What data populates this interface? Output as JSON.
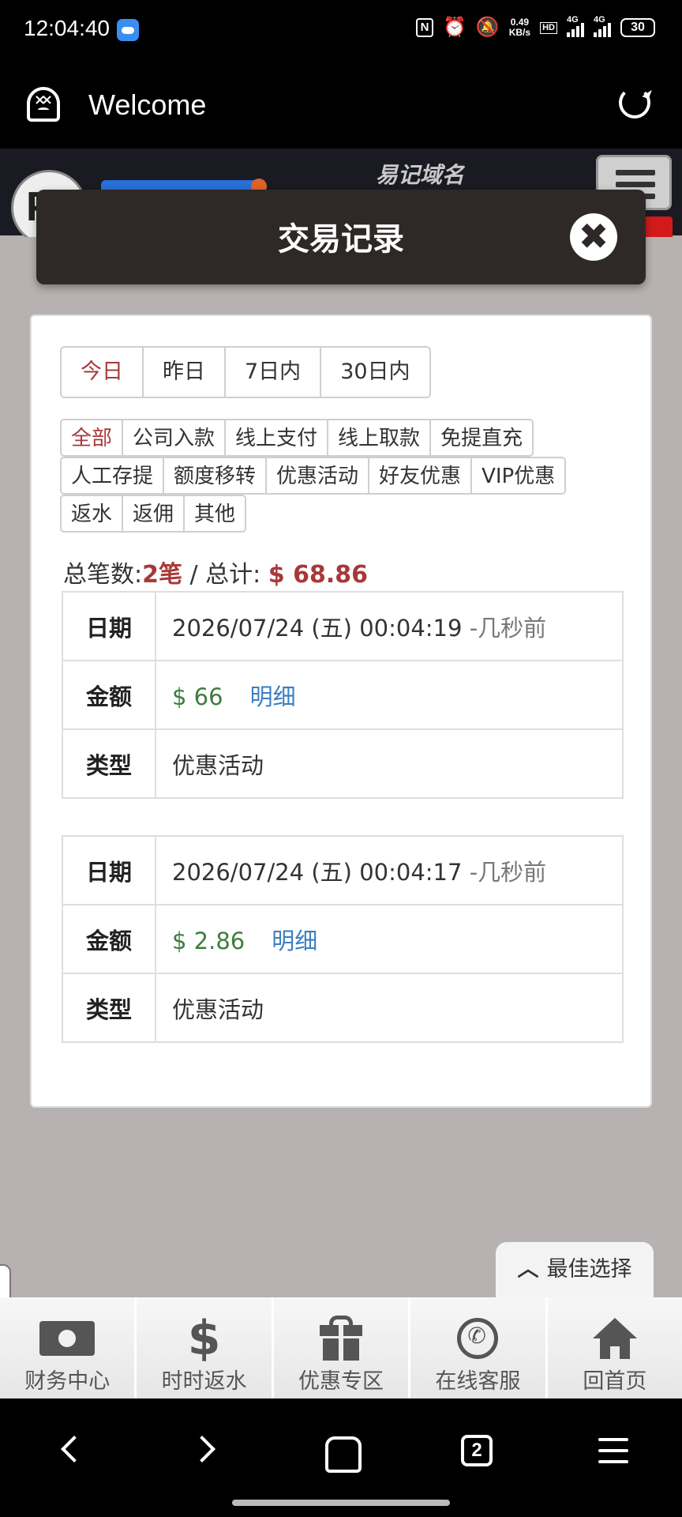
{
  "status_bar": {
    "time": "12:04:40",
    "net_speed_value": "0.49",
    "net_speed_unit": "KB/s",
    "hd_label": "HD",
    "network_1": "4G",
    "network_2": "4G",
    "battery": "30"
  },
  "browser": {
    "title": "Welcome"
  },
  "site": {
    "domain_text": "易记域名",
    "logo_letter": "P"
  },
  "modal": {
    "title": "交易记录",
    "close_symbol": "✖"
  },
  "date_tabs": [
    "今日",
    "昨日",
    "7日内",
    "30日内"
  ],
  "type_tabs": [
    [
      "全部",
      "公司入款",
      "线上支付",
      "线上取款",
      "免提直充"
    ],
    [
      "人工存提",
      "额度移转",
      "优惠活动",
      "好友优惠",
      "VIP优惠"
    ],
    [
      "返水",
      "返佣",
      "其他"
    ]
  ],
  "summary": {
    "count_label": "总笔数:",
    "count_value": "2笔",
    "separator": " / 总计:",
    "total_value": "$ 68.86"
  },
  "record_labels": {
    "date": "日期",
    "amount": "金额",
    "type": "类型",
    "detail": "明细"
  },
  "records": [
    {
      "date": "2026/07/24 (五) 00:04:19",
      "ago": "-几秒前",
      "amount": "$ 66",
      "type": "优惠活动"
    },
    {
      "date": "2026/07/24 (五) 00:04:17",
      "ago": "-几秒前",
      "amount": "$ 2.86",
      "type": "优惠活动"
    }
  ],
  "best_choice": {
    "icon": "chevron-up-icon",
    "label": "最佳选择"
  },
  "bottom_nav": [
    {
      "icon": "money-icon",
      "label": "财务中心"
    },
    {
      "icon": "dollar-icon",
      "label": "时时返水"
    },
    {
      "icon": "gift-icon",
      "label": "优惠专区"
    },
    {
      "icon": "whatsapp-icon",
      "label": "在线客服"
    },
    {
      "icon": "home-icon",
      "label": "回首页"
    }
  ],
  "android_nav": {
    "tab_count": "2"
  },
  "colors": {
    "accent_red": "#a83838",
    "money_green": "#3e7d3e",
    "link_blue": "#3a7fc1",
    "modal_header_bg": "#2e2827"
  }
}
